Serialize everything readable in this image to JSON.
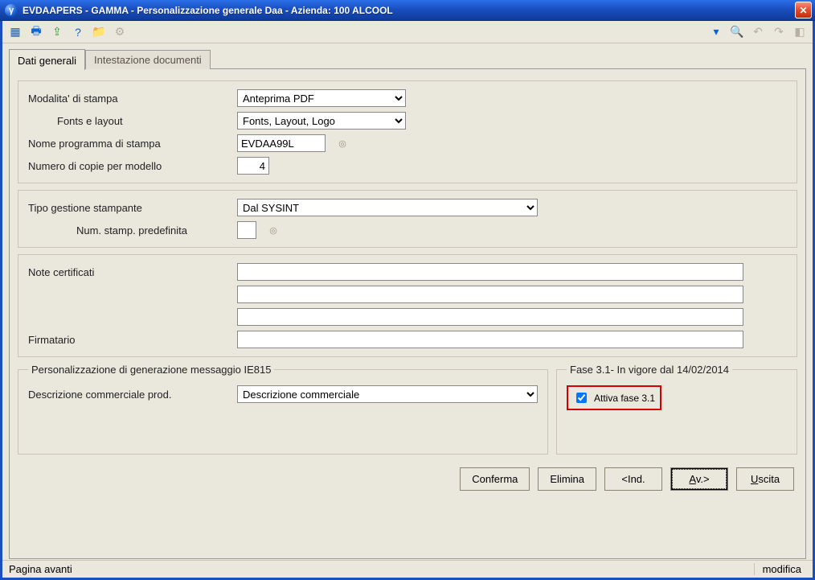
{
  "window": {
    "title": "EVDAAPERS - GAMMA - Personalizzazione generale Daa - Azienda:  100 ALCOOL"
  },
  "tabs": {
    "general": "Dati generali",
    "header": "Intestazione documenti"
  },
  "group1": {
    "print_mode_label": "Modalita' di stampa",
    "print_mode_value": "Anteprima PDF",
    "fonts_label": "Fonts e layout",
    "fonts_value": "Fonts, Layout, Logo",
    "program_label": "Nome programma di stampa",
    "program_value": "EVDAA99L",
    "copies_label": "Numero di copie per modello",
    "copies_value": "4"
  },
  "group2": {
    "printer_type_label": "Tipo gestione stampante",
    "printer_type_value": "Dal SYSINT",
    "default_printer_label": "Num. stamp. predefinita",
    "default_printer_value": ""
  },
  "group3": {
    "notes_label": "Note certificati",
    "notes1": "",
    "notes2": "",
    "notes3": "",
    "signer_label": "Firmatario",
    "signer_value": ""
  },
  "ie815": {
    "legend": "Personalizzazione di generazione messaggio IE815",
    "desc_label": "Descrizione commerciale prod.",
    "desc_value": "Descrizione commerciale"
  },
  "fase31": {
    "legend": "Fase 3.1- In vigore dal 14/02/2014",
    "checkbox_label": "Attiva fase 3.1"
  },
  "buttons": {
    "confirm": "Conferma",
    "delete": "Elimina",
    "prev": "<Ind.",
    "next": "Av.>",
    "exit": "Uscita"
  },
  "status": {
    "left": "Pagina avanti",
    "right": "modifica"
  }
}
